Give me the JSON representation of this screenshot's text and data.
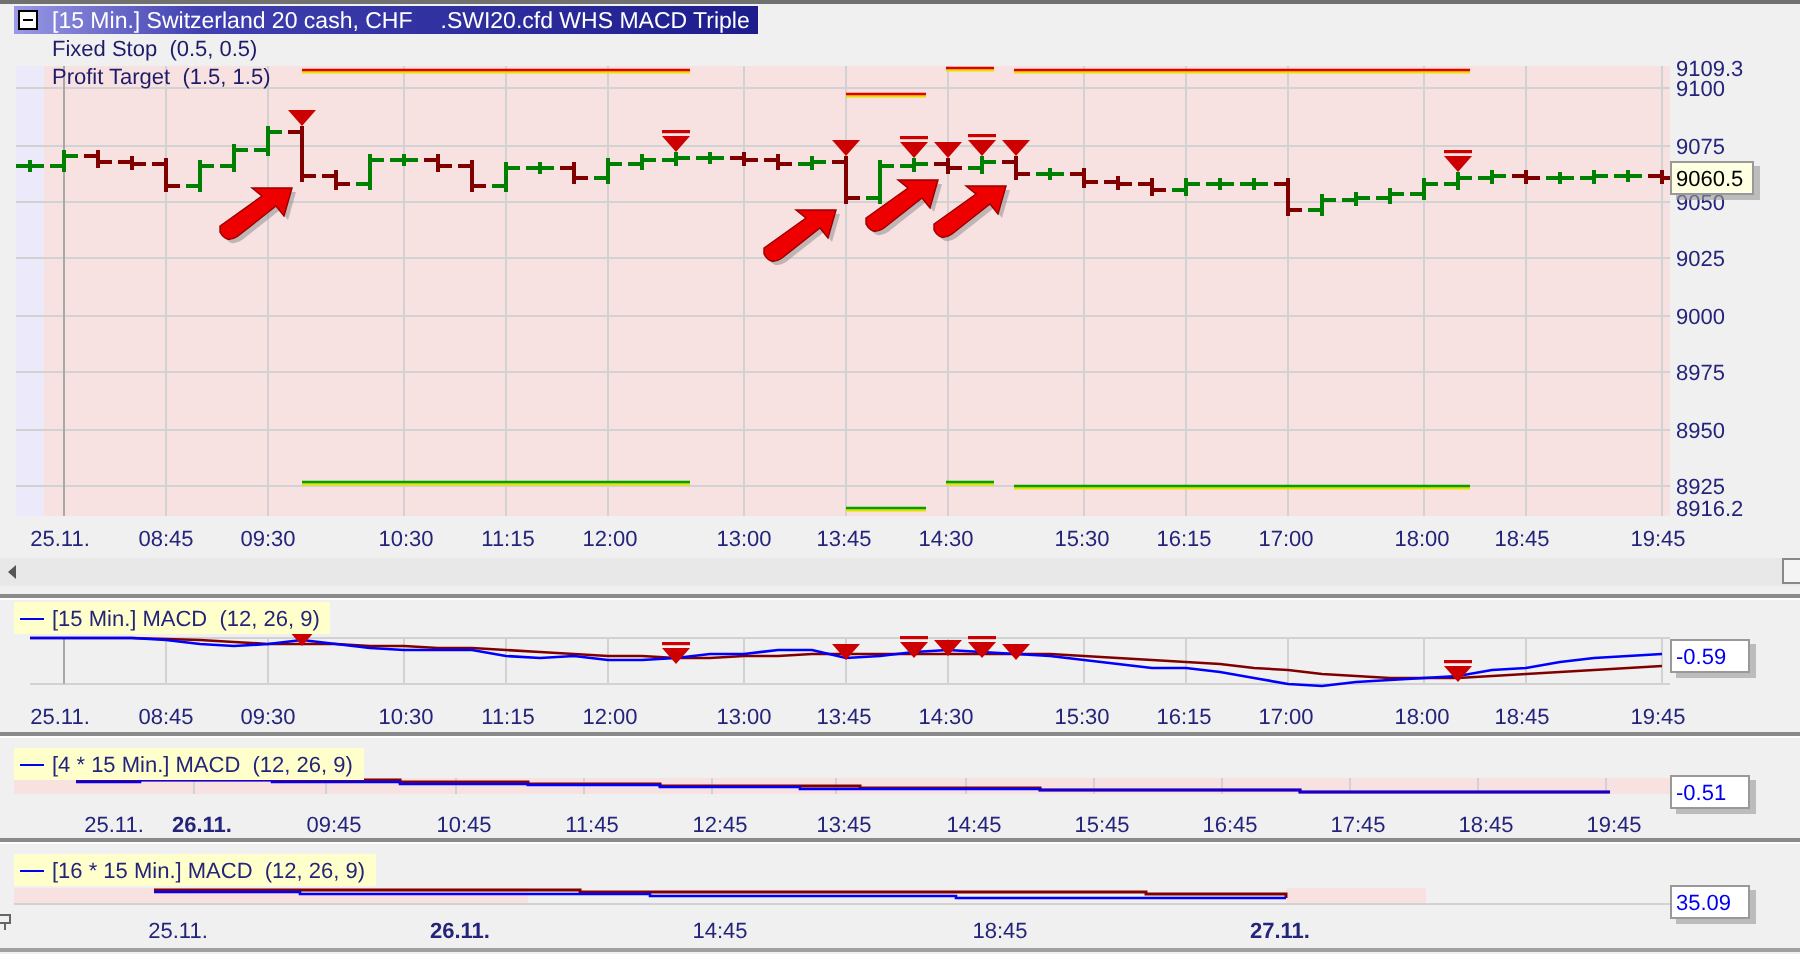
{
  "title_bar": {
    "instrument": "[15 Min.] Switzerland 20 cash, CHF",
    "strategy": ".SWI20.cfd WHS MACD Triple"
  },
  "overlay_labels": [
    "Fixed Stop  (0.5, 0.5)",
    "Profit Target  (1.5, 1.5)"
  ],
  "price_pane": {
    "current_value": "9060.5",
    "y_labels": [
      "9109.3",
      "9100",
      "9075",
      "9050",
      "9025",
      "9000",
      "8975",
      "8950",
      "8925",
      "8916.2"
    ],
    "x_labels": [
      {
        "label": "25.11.",
        "bold": false
      },
      {
        "label": "08:45",
        "bold": false
      },
      {
        "label": "09:30",
        "bold": false
      },
      {
        "label": "10:30",
        "bold": false
      },
      {
        "label": "11:15",
        "bold": false
      },
      {
        "label": "12:00",
        "bold": false
      },
      {
        "label": "13:00",
        "bold": false
      },
      {
        "label": "13:45",
        "bold": false
      },
      {
        "label": "14:30",
        "bold": false
      },
      {
        "label": "15:30",
        "bold": false
      },
      {
        "label": "16:15",
        "bold": false
      },
      {
        "label": "17:00",
        "bold": false
      },
      {
        "label": "18:00",
        "bold": false
      },
      {
        "label": "18:45",
        "bold": false
      },
      {
        "label": "19:45",
        "bold": false
      }
    ]
  },
  "macd_panes": [
    {
      "legend": "[15 Min.] MACD  (12, 26, 9)",
      "value": "-0.59",
      "x_labels": [
        {
          "label": "25.11.",
          "bold": false
        },
        {
          "label": "08:45",
          "bold": false
        },
        {
          "label": "09:30",
          "bold": false
        },
        {
          "label": "10:30",
          "bold": false
        },
        {
          "label": "11:15",
          "bold": false
        },
        {
          "label": "12:00",
          "bold": false
        },
        {
          "label": "13:00",
          "bold": false
        },
        {
          "label": "13:45",
          "bold": false
        },
        {
          "label": "14:30",
          "bold": false
        },
        {
          "label": "15:30",
          "bold": false
        },
        {
          "label": "16:15",
          "bold": false
        },
        {
          "label": "17:00",
          "bold": false
        },
        {
          "label": "18:00",
          "bold": false
        },
        {
          "label": "18:45",
          "bold": false
        },
        {
          "label": "19:45",
          "bold": false
        }
      ]
    },
    {
      "legend": "[4 * 15 Min.] MACD  (12, 26, 9)",
      "value": "-0.51",
      "x_labels": [
        {
          "label": "25.11.",
          "bold": false
        },
        {
          "label": "26.11.",
          "bold": true
        },
        {
          "label": "09:45",
          "bold": false
        },
        {
          "label": "10:45",
          "bold": false
        },
        {
          "label": "11:45",
          "bold": false
        },
        {
          "label": "12:45",
          "bold": false
        },
        {
          "label": "13:45",
          "bold": false
        },
        {
          "label": "14:45",
          "bold": false
        },
        {
          "label": "15:45",
          "bold": false
        },
        {
          "label": "16:45",
          "bold": false
        },
        {
          "label": "17:45",
          "bold": false
        },
        {
          "label": "18:45",
          "bold": false
        },
        {
          "label": "19:45",
          "bold": false
        }
      ]
    },
    {
      "legend": "[16 * 15 Min.] MACD  (12, 26, 9)",
      "value": "35.09",
      "x_labels": [
        {
          "label": "25.11.",
          "bold": false
        },
        {
          "label": "26.11.",
          "bold": true
        },
        {
          "label": "14:45",
          "bold": false
        },
        {
          "label": "18:45",
          "bold": false
        },
        {
          "label": "27.11.",
          "bold": true
        }
      ]
    }
  ]
}
